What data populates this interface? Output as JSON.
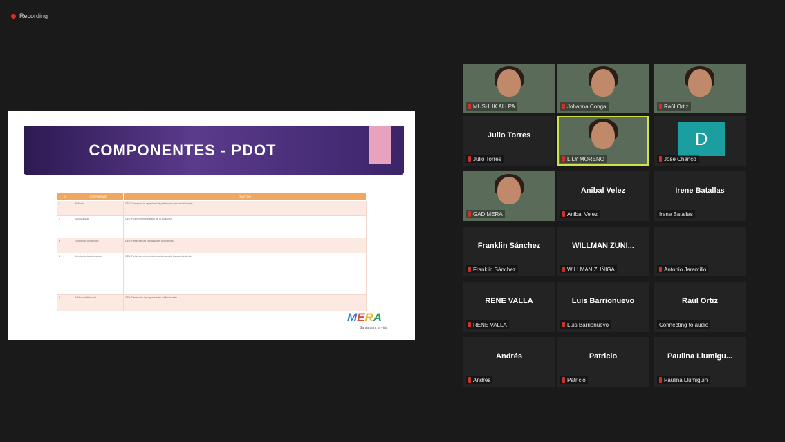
{
  "recording": {
    "label": "Recording"
  },
  "slide": {
    "title": "COMPONENTES - PDOT",
    "table": {
      "headers": [
        "N°",
        "COMPONENTE",
        "OBJETIVO"
      ],
      "rows": [
        [
          "1",
          "Biofísico",
          "OE1: Conservar la capacidad del patrimonio natural del cantón"
        ],
        [
          "2",
          "Sociocultural",
          "OE2: Promover el bienestar de la población"
        ],
        [
          "3",
          "Económico productivo",
          "OE3: Fortalecer las capacidades productivas"
        ],
        [
          "4",
          "Asentamientos humanos",
          "OE4: Fortalecer el crecimiento ordenado de los asentamientos"
        ],
        [
          "5",
          "Político institucional",
          "OE5: Desarrollar las capacidades institucionales"
        ]
      ]
    },
    "logo": {
      "text1": "M",
      "text2": "E",
      "text3": "R",
      "text4": "A",
      "sub": "Santa para la vida"
    }
  },
  "participants": [
    {
      "display": "",
      "label": "MUSHUK ALLPA",
      "type": "video",
      "bg": "bg-warm"
    },
    {
      "display": "",
      "label": "Johanna Conga",
      "type": "video",
      "bg": "bg-white"
    },
    {
      "display": "",
      "label": "Raúl Ortiz",
      "type": "video",
      "bg": "bg-room"
    },
    {
      "display": "Julio Torres",
      "label": "Julio Torres",
      "type": "name"
    },
    {
      "display": "",
      "label": "LILY MORENO",
      "type": "video",
      "bg": "bg-dark",
      "active": true
    },
    {
      "display": "D",
      "label": "Jose Chanco",
      "type": "avatar"
    },
    {
      "display": "",
      "label": "GAD MERA",
      "type": "video",
      "bg": "bg-white"
    },
    {
      "display": "Anibal Velez",
      "label": "Anibal Velez",
      "type": "name"
    },
    {
      "display": "Irene Batallas",
      "label": "Irene Batallas",
      "type": "name",
      "nomic": true
    },
    {
      "display": "Franklin Sánchez",
      "label": "Franklin Sánchez",
      "type": "name"
    },
    {
      "display": "WILLMAN ZUÑI...",
      "label": "WILLMAN ZUÑIGA",
      "type": "name"
    },
    {
      "display": "",
      "label": "Antonio Jaramillo",
      "type": "name"
    },
    {
      "display": "RENE VALLA",
      "label": "RENE VALLA",
      "type": "name"
    },
    {
      "display": "Luis Barrionuevo",
      "label": "Luis Barrionuevo",
      "type": "name"
    },
    {
      "display": "Raúl Ortiz",
      "label": "Connecting to audio",
      "type": "name",
      "nomic": true
    },
    {
      "display": "Andrés",
      "label": "Andrés",
      "type": "name"
    },
    {
      "display": "Patricio",
      "label": "Patricio",
      "type": "name"
    },
    {
      "display": "Paulina Llumigu...",
      "label": "Paulina Llumiguin",
      "type": "name"
    }
  ]
}
